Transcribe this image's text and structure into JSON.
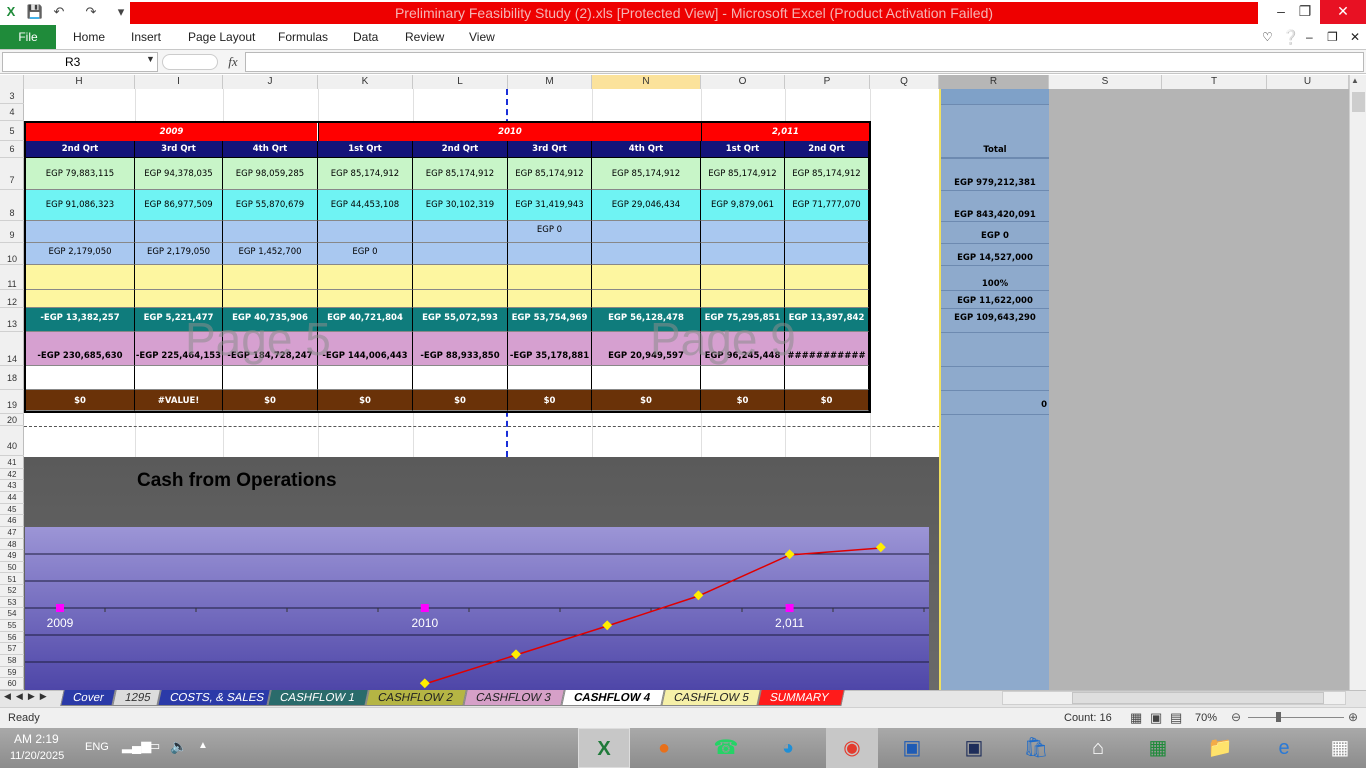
{
  "window": {
    "title": "Preliminary Feasibility Study (2).xls  [Protected View]  -  Microsoft Excel (Product Activation Failed)"
  },
  "ribbon": {
    "file": "File",
    "tabs": [
      "Home",
      "Insert",
      "Page Layout",
      "Formulas",
      "Data",
      "Review",
      "View"
    ]
  },
  "formula_bar": {
    "name_box": "R3",
    "fx": "fx",
    "value": ""
  },
  "columns": [
    "H",
    "I",
    "J",
    "K",
    "L",
    "M",
    "N",
    "O",
    "P",
    "Q",
    "R",
    "S",
    "T",
    "U"
  ],
  "rows": [
    "3",
    "4",
    "5",
    "6",
    "7",
    "8",
    "9",
    "10",
    "11",
    "12",
    "13",
    "14",
    "18",
    "19",
    "20",
    "40",
    "41",
    "42",
    "43",
    "44",
    "45",
    "46",
    "47",
    "48",
    "49",
    "50",
    "51",
    "52",
    "53",
    "54",
    "55",
    "56",
    "57",
    "58",
    "59",
    "60"
  ],
  "table": {
    "years": [
      "2009",
      "2010",
      "2,011"
    ],
    "quarters": [
      "2nd Qrt",
      "3rd Qrt",
      "4th Qrt",
      "1st Qrt",
      "2nd Qrt",
      "3rd Qrt",
      "4th Qrt",
      "1st Qrt",
      "2nd Qrt"
    ],
    "row7": [
      "EGP 79,883,115",
      "EGP 94,378,035",
      "EGP 98,059,285",
      "EGP 85,174,912",
      "EGP 85,174,912",
      "EGP 85,174,912",
      "EGP 85,174,912",
      "EGP 85,174,912",
      "EGP 85,174,912"
    ],
    "row8": [
      "EGP 91,086,323",
      "EGP 86,977,509",
      "EGP 55,870,679",
      "EGP 44,453,108",
      "EGP 30,102,319",
      "EGP 31,419,943",
      "EGP 29,046,434",
      "EGP 9,879,061",
      "EGP 71,777,070"
    ],
    "row9": [
      "",
      "",
      "",
      "",
      "",
      "EGP 0",
      "",
      "",
      ""
    ],
    "row10": [
      "EGP 2,179,050",
      "EGP 2,179,050",
      "EGP 1,452,700",
      "EGP 0",
      "",
      "",
      "",
      "",
      ""
    ],
    "row13": [
      "-EGP 13,382,257",
      "EGP 5,221,477",
      "EGP 40,735,906",
      "EGP 40,721,804",
      "EGP 55,072,593",
      "EGP 53,754,969",
      "EGP 56,128,478",
      "EGP 75,295,851",
      "EGP 13,397,842"
    ],
    "row14": [
      "-EGP 230,685,630",
      "-EGP 225,464,153",
      "-EGP 184,728,247",
      "-EGP 144,006,443",
      "-EGP 88,933,850",
      "-EGP 35,178,881",
      "EGP 20,949,597",
      "EGP 96,245,448",
      "###########"
    ],
    "row19": [
      "$0",
      "#VALUE!",
      "$0",
      "$0",
      "$0",
      "$0",
      "$0",
      "$0",
      "$0"
    ]
  },
  "total_col": {
    "header": "Total",
    "values": [
      "EGP 979,212,381",
      "EGP 843,420,091",
      "EGP 0",
      "EGP 14,527,000",
      "100%",
      "EGP 11,622,000",
      "EGP 109,643,290"
    ],
    "row19": "0"
  },
  "watermarks": [
    "Page 5",
    "Page 9"
  ],
  "chart_data": {
    "type": "line",
    "title": "Cash from Operations",
    "x_labels": [
      "2009",
      "2010",
      "2,011"
    ],
    "series": [
      {
        "values": [
          null,
          null,
          null,
          null,
          1,
          2,
          3,
          4,
          5,
          6
        ]
      },
      {
        "values": [
          0,
          null,
          null,
          null,
          0,
          null,
          null,
          null,
          0,
          null
        ]
      }
    ],
    "colors": {
      "line": "#e00000",
      "marker": "#ffee00",
      "marker2": "#ff00ff"
    }
  },
  "sheet_tabs": [
    {
      "label": "Cover",
      "bg": "#2b3aa8",
      "fg": "#ffffff"
    },
    {
      "label": "1295",
      "bg": "#dcdcdc",
      "fg": "#333333"
    },
    {
      "label": "COSTS, & SALES",
      "bg": "#2b3aa8",
      "fg": "#ffffff"
    },
    {
      "label": "CASHFLOW 1",
      "bg": "#2a6b6b",
      "fg": "#ffffff"
    },
    {
      "label": "CASHFLOW  2",
      "bg": "#b5b544",
      "fg": "#222222"
    },
    {
      "label": "CASHFLOW  3",
      "bg": "#d6a0c8",
      "fg": "#222222"
    },
    {
      "label": "CASHFLOW  4",
      "bg": "#ffffff",
      "fg": "#000000"
    },
    {
      "label": "CASHFLOW  5",
      "bg": "#f6f0a8",
      "fg": "#222222"
    },
    {
      "label": "SUMMARY",
      "bg": "#ff1b1b",
      "fg": "#ffffff"
    }
  ],
  "status": {
    "ready": "Ready",
    "count": "Count: 16",
    "zoom": "70%"
  },
  "taskbar": {
    "time": "AM 2:19",
    "date": "11/20/2025",
    "lang": "ENG"
  }
}
